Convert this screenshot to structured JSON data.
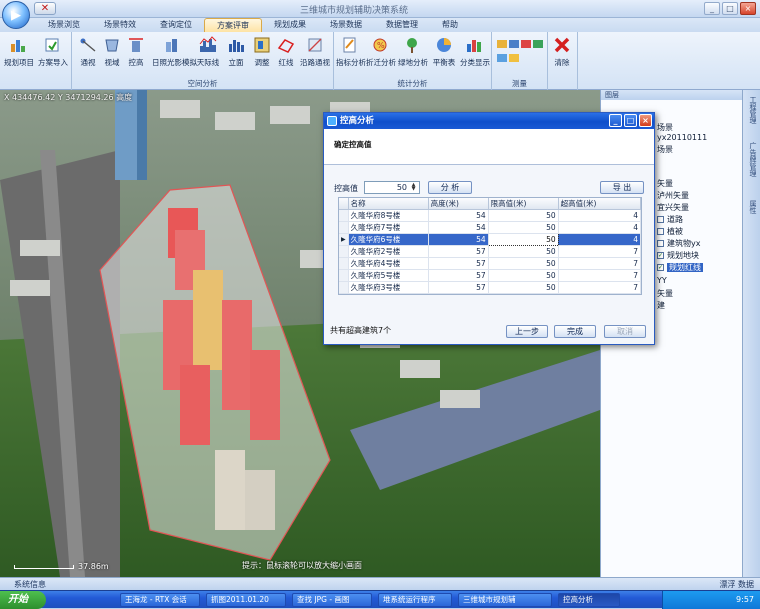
{
  "app": {
    "title": "三维城市规划辅助决策系统",
    "menu": [
      "场景浏览",
      "场景特效",
      "查询定位",
      "方案评审",
      "规划成果",
      "场景数据",
      "数据管理",
      "帮助"
    ],
    "active_menu": "方案评审",
    "window_min": "_",
    "window_max": "□",
    "window_close": "×"
  },
  "ribbon": {
    "groups": [
      {
        "label": ""
      },
      {
        "label": "空间分析"
      },
      {
        "label": "统计分析"
      },
      {
        "label": "测量"
      },
      {
        "label": ""
      }
    ],
    "buttons": [
      "规划项目",
      "方案导入",
      "通视",
      "视域",
      "控高",
      "日照光影模拟",
      "天际线",
      "立面",
      "调整",
      "红线",
      "沿路通视",
      "指标分析",
      "折迁分析",
      "绿地分析",
      "平衡表",
      "分类显示",
      "清除"
    ]
  },
  "scene": {
    "coordinates": "X 434476.42  Y 3471294.26  高度",
    "hint": "提示：鼠标滚轮可以放大缩小画面",
    "scale": "37.86m"
  },
  "dialog": {
    "title": "控高分析",
    "header": "确定控高值",
    "control_label": "控高值",
    "control_value": "50",
    "analyze_button": "分 析",
    "export_button": "导 出",
    "columns": [
      "名称",
      "高度(米)",
      "限高值(米)",
      "超高值(米)"
    ],
    "rows": [
      {
        "name": "久隆华府8号楼",
        "height": "54",
        "limit": "50",
        "over": "4"
      },
      {
        "name": "久隆华府7号楼",
        "height": "54",
        "limit": "50",
        "over": "4"
      },
      {
        "name": "久隆华府6号楼",
        "height": "54",
        "limit": "50",
        "over": "4"
      },
      {
        "name": "久隆华府2号楼",
        "height": "57",
        "limit": "50",
        "over": "7"
      },
      {
        "name": "久隆华府4号楼",
        "height": "57",
        "limit": "50",
        "over": "7"
      },
      {
        "name": "久隆华府5号楼",
        "height": "57",
        "limit": "50",
        "over": "7"
      },
      {
        "name": "久隆华府3号楼",
        "height": "57",
        "limit": "50",
        "over": "7"
      }
    ],
    "selected_row": 2,
    "summary": "共有超高建筑7个",
    "prev_button": "上一步",
    "finish_button": "完成",
    "cancel_button": "取消"
  },
  "right_panel": {
    "header": "图层",
    "layers": [
      {
        "label": "场景",
        "checked": null
      },
      {
        "label": "yx20110111",
        "checked": null
      },
      {
        "label": "场景",
        "checked": null
      },
      {
        "label": "矢量",
        "checked": null
      },
      {
        "label": "泸州矢量",
        "checked": null
      },
      {
        "label": "宜兴矢量",
        "checked": null
      },
      {
        "label": "道路",
        "checked": false
      },
      {
        "label": "植被",
        "checked": false
      },
      {
        "label": "建筑物yx",
        "checked": false
      },
      {
        "label": "规划地块",
        "checked": true
      },
      {
        "label": "规划红线",
        "checked": true
      },
      {
        "label": "YY",
        "checked": null
      },
      {
        "label": "矢量",
        "checked": null
      },
      {
        "label": "建",
        "checked": null
      }
    ],
    "selected_layer": "规划红线"
  },
  "side_tabs": [
    "工程管理",
    "广告牌管理",
    "属性"
  ],
  "status": {
    "left": "系统信息",
    "right": "漂浮 数据"
  },
  "taskbar": {
    "start": "开始",
    "items": [
      "王海龙 - RTX 会话",
      "抓图2011.01.20",
      "查找 JPG - 画图",
      "堆系统运行程序",
      "三维城市规划辅",
      "控高分析"
    ],
    "active_item": "控高分析",
    "clock": "9:57"
  }
}
